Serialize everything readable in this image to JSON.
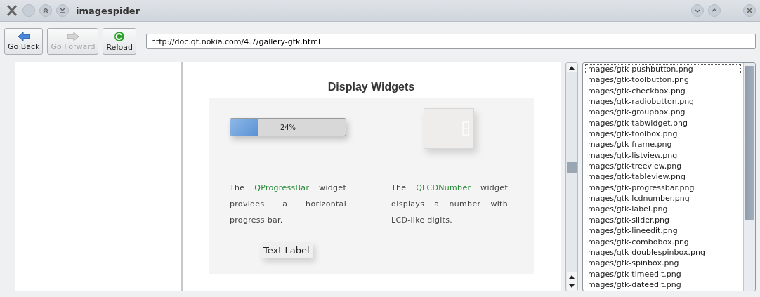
{
  "window": {
    "title": "imagespider"
  },
  "toolbar": {
    "buttons": [
      {
        "label": "Go Back",
        "kind": "back",
        "disabled": false
      },
      {
        "label": "Go Forward",
        "kind": "forward",
        "disabled": true
      },
      {
        "label": "Reload",
        "kind": "reload",
        "disabled": false
      }
    ],
    "url": "http://doc.qt.nokia.com/4.7/gallery-gtk.html"
  },
  "page": {
    "heading": "Display Widgets",
    "progress": {
      "level": 0.24,
      "reading": "24%"
    },
    "descriptions": [
      {
        "before": "The",
        "link": "QProgressBar",
        "after": "widget provides a horizontal progress bar."
      },
      {
        "before": "The",
        "link": "QLCDNumber",
        "after": "widget displays a number with LCD-like digits."
      }
    ],
    "label_sample": "Text Label"
  },
  "image_list": [
    {
      "text": "images/gtk-pushbutton.png",
      "selected": true
    },
    {
      "text": "images/gtk-toolbutton.png",
      "selected": false
    },
    {
      "text": "images/gtk-checkbox.png",
      "selected": false
    },
    {
      "text": "images/gtk-radiobutton.png",
      "selected": false
    },
    {
      "text": "images/gtk-groupbox.png",
      "selected": false
    },
    {
      "text": "images/gtk-tabwidget.png",
      "selected": false
    },
    {
      "text": "images/gtk-toolbox.png",
      "selected": false
    },
    {
      "text": "images/gtk-frame.png",
      "selected": false
    },
    {
      "text": "images/gtk-listview.png",
      "selected": false
    },
    {
      "text": "images/gtk-treeview.png",
      "selected": false
    },
    {
      "text": "images/gtk-tableview.png",
      "selected": false
    },
    {
      "text": "images/gtk-progressbar.png",
      "selected": false
    },
    {
      "text": "images/gtk-lcdnumber.png",
      "selected": false
    },
    {
      "text": "images/gtk-label.png",
      "selected": false
    },
    {
      "text": "images/gtk-slider.png",
      "selected": false
    },
    {
      "text": "images/gtk-lineedit.png",
      "selected": false
    },
    {
      "text": "images/gtk-combobox.png",
      "selected": false
    },
    {
      "text": "images/gtk-doublespinbox.png",
      "selected": false
    },
    {
      "text": "images/gtk-spinbox.png",
      "selected": false
    },
    {
      "text": "images/gtk-timeedit.png",
      "selected": false
    },
    {
      "text": "images/gtk-dateedit.png",
      "selected": false
    }
  ]
}
